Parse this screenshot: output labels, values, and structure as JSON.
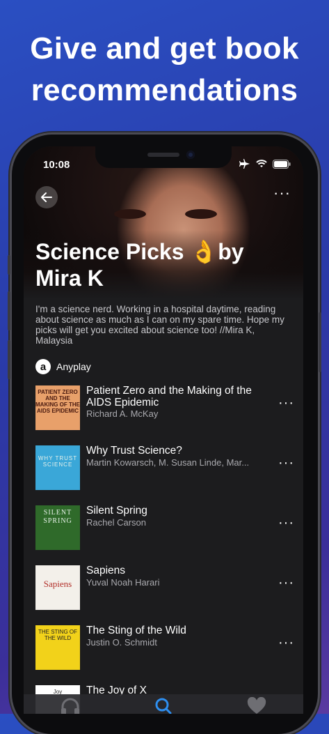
{
  "promo": {
    "headline_line1": "Give and get book",
    "headline_line2": "recommendations"
  },
  "status_bar": {
    "time": "10:08"
  },
  "list": {
    "title": "Science Picks 👌by Mira K",
    "description": "I'm a science nerd. Working in a hospital daytime, reading about science as much as I can on my spare time. Hope my picks will get you excited about science too! //Mira K, Malaysia",
    "source_logo": "a",
    "source_name": "Anyplay"
  },
  "books": [
    {
      "title": "Patient Zero and the Making of the AIDS Epidemic",
      "author": "Richard A. McKay",
      "cover_text": "PATIENT ZERO AND THE MAKING OF THE AIDS EPIDEMIC",
      "cover_color": "#e8a06a"
    },
    {
      "title": "Why Trust Science?",
      "author": "Martin Kowarsch, M. Susan Linde, Mar...",
      "cover_text": "WHY TRUST SCIENCE",
      "cover_color": "#3aa7d8"
    },
    {
      "title": "Silent Spring",
      "author": "Rachel Carson",
      "cover_text": "SILENT SPRING",
      "cover_color": "#2f6a2a"
    },
    {
      "title": "Sapiens",
      "author": "Yuval Noah Harari",
      "cover_text": "Sapiens",
      "cover_color": "#f3f0ea"
    },
    {
      "title": "The Sting of the Wild",
      "author": "Justin O. Schmidt",
      "cover_text": "THE STING OF THE WILD",
      "cover_color": "#f2d21a"
    },
    {
      "title": "The Joy of X",
      "author": "",
      "cover_text": "Joy",
      "cover_color": "#ffffff"
    }
  ],
  "tabbar": {
    "icons": [
      "headphones-icon",
      "search-icon",
      "heart-icon"
    ],
    "active": "search-icon"
  },
  "colors": {
    "active_tab": "#2e8ff0",
    "background_top": "#2a4fc2",
    "background_bottom": "#5a3aa0"
  }
}
